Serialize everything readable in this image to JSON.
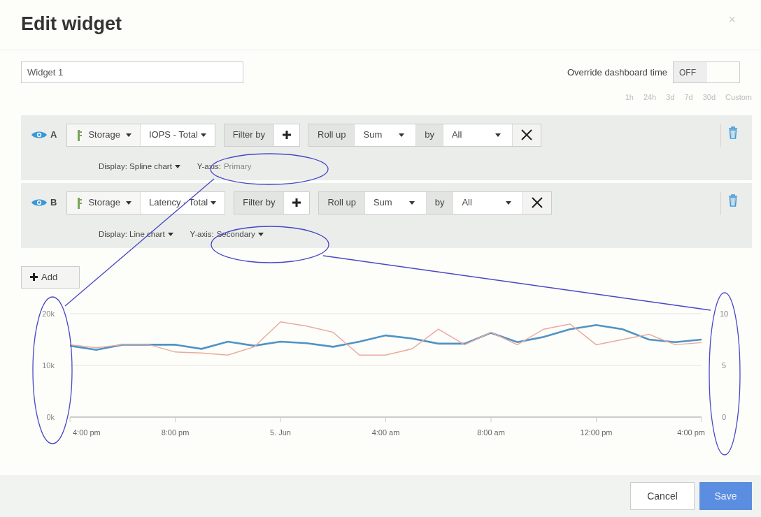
{
  "dialog": {
    "title": "Edit widget",
    "close": "×"
  },
  "name_field": {
    "value": "Widget 1"
  },
  "override": {
    "label": "Override dashboard time",
    "toggle": "OFF",
    "on": false
  },
  "time_ranges": [
    {
      "label": "1h",
      "disabled": true
    },
    {
      "label": "24h",
      "disabled": true
    },
    {
      "label": "3d",
      "disabled": true
    },
    {
      "label": "7d",
      "disabled": true
    },
    {
      "label": "30d",
      "disabled": true
    },
    {
      "label": "Custom",
      "disabled": true
    }
  ],
  "queries": [
    {
      "letter": "A",
      "object": "Storage",
      "metric": "IOPS - Total",
      "filter_label": "Filter by",
      "rollup_label": "Roll up",
      "rollup": "Sum",
      "by_label": "by",
      "group": "All",
      "display": "Display: Spline chart",
      "yaxis_label": "Y-axis:",
      "yaxis": "Primary",
      "yaxis_disabled": true
    },
    {
      "letter": "B",
      "object": "Storage",
      "metric": "Latency - Total",
      "filter_label": "Filter by",
      "rollup_label": "Roll up",
      "rollup": "Sum",
      "by_label": "by",
      "group": "All",
      "display": "Display: Line chart",
      "yaxis_label": "Y-axis:",
      "yaxis": "Secondary",
      "yaxis_disabled": false
    }
  ],
  "add_button": "Add",
  "chart": {
    "chart_data": {
      "type": "line",
      "categories": [
        "4:00 pm",
        null,
        null,
        null,
        "8:00 pm",
        null,
        null,
        null,
        "5. Jun",
        null,
        null,
        null,
        "4:00 am",
        null,
        null,
        null,
        "8:00 am",
        null,
        null,
        null,
        "12:00 pm",
        null,
        null,
        null,
        "4:00 pm"
      ],
      "ylim": [
        0,
        20000
      ],
      "yticks": [
        {
          "value": 0,
          "label": "0k"
        },
        {
          "value": 10000,
          "label": "10k"
        },
        {
          "value": 20000,
          "label": "20k"
        }
      ],
      "y2lim": [
        0,
        10
      ],
      "y2ticks": [
        {
          "value": 0,
          "label": "0"
        },
        {
          "value": 5,
          "label": "5"
        },
        {
          "value": 10,
          "label": "10"
        }
      ],
      "series": [
        {
          "color": "#4f93c4",
          "values": [
            13800,
            13000,
            14000,
            14000,
            14000,
            13200,
            14600,
            13800,
            14600,
            14300,
            13600,
            14600,
            15800,
            15200,
            14200,
            14200,
            16300,
            14500,
            15500,
            17000,
            17800,
            17000,
            15000,
            14500,
            15000
          ]
        },
        {
          "color": "#eaa99b",
          "axis": "y2",
          "values": [
            7,
            6.7,
            7,
            7,
            6.3,
            6.2,
            6,
            6.8,
            9.2,
            8.8,
            8.2,
            6,
            6,
            6.6,
            8.5,
            7,
            8.2,
            7,
            8.5,
            9,
            7,
            7.5,
            8,
            7,
            7.2
          ]
        }
      ]
    }
  },
  "footer": {
    "cancel": "Cancel",
    "save": "Save"
  }
}
